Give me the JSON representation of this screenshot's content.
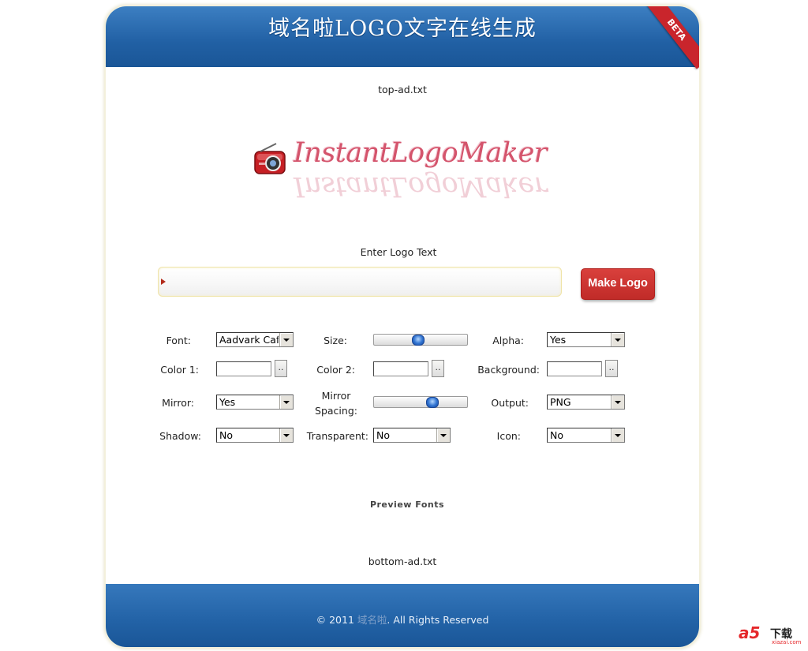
{
  "header": {
    "title": "域名啦LOGO文字在线生成",
    "badge": "BETA"
  },
  "ads": {
    "top": "top-ad.txt",
    "bottom": "bottom-ad.txt"
  },
  "logo": {
    "text": "InstantLogoMaker"
  },
  "entry": {
    "label": "Enter Logo Text",
    "value": "",
    "button": "Make Logo"
  },
  "options": {
    "font": {
      "label": "Font:",
      "value": "Aadvark Cafe"
    },
    "size": {
      "label": "Size:",
      "level": 0.47
    },
    "alpha": {
      "label": "Alpha:",
      "value": "Yes"
    },
    "color1": {
      "label": "Color 1:",
      "value": "",
      "button": ".."
    },
    "color2": {
      "label": "Color 2:",
      "value": "",
      "button": ".."
    },
    "background": {
      "label": "Background:",
      "value": "",
      "button": ".."
    },
    "mirror": {
      "label": "Mirror:",
      "value": "Yes"
    },
    "mirror_spacing": {
      "label_line1": "Mirror",
      "label_line2": "Spacing:",
      "level": 0.65
    },
    "output": {
      "label": "Output:",
      "value": "PNG"
    },
    "shadow": {
      "label": "Shadow:",
      "value": "No"
    },
    "transparent": {
      "label": "Transparent:",
      "value": "No"
    },
    "icon": {
      "label": "Icon:",
      "value": "No"
    }
  },
  "preview": {
    "label": "Preview Fonts"
  },
  "footer": {
    "prefix": "© 2011 ",
    "brand": "域名啦",
    "suffix": ". All Rights Reserved"
  },
  "watermark": {
    "logo": "a5",
    "title": "下载",
    "site": "xiazai.com"
  }
}
